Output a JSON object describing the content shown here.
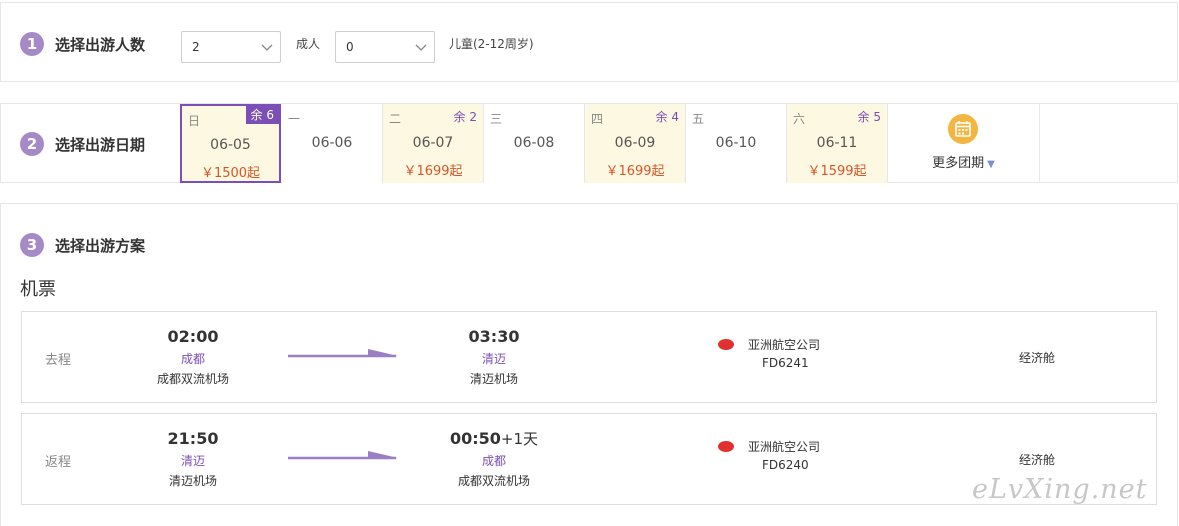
{
  "step1": {
    "num": "1",
    "title": "选择出游人数",
    "adults": {
      "value": "2",
      "label": "成人"
    },
    "children": {
      "value": "0",
      "label": "儿童(2-12周岁)"
    }
  },
  "step2": {
    "num": "2",
    "title": "选择出游日期",
    "days": [
      {
        "weekday": "日",
        "remain": "余 6",
        "date": "06-05",
        "price": "￥1500起",
        "selected": true
      },
      {
        "weekday": "一",
        "remain": "",
        "date": "06-06",
        "price": ""
      },
      {
        "weekday": "二",
        "remain": "余 2",
        "date": "06-07",
        "price": "￥1699起"
      },
      {
        "weekday": "三",
        "remain": "",
        "date": "06-08",
        "price": ""
      },
      {
        "weekday": "四",
        "remain": "余 4",
        "date": "06-09",
        "price": "￥1699起"
      },
      {
        "weekday": "五",
        "remain": "",
        "date": "06-10",
        "price": ""
      },
      {
        "weekday": "六",
        "remain": "余 5",
        "date": "06-11",
        "price": "￥1599起"
      }
    ],
    "more_label": "更多团期",
    "more_icon": "calendar-icon"
  },
  "step3": {
    "num": "3",
    "title": "选择出游方案",
    "subtitle": "机票",
    "flights": [
      {
        "direction": "去程",
        "dep_time": "02:00",
        "dep_city": "成都",
        "dep_airport": "成都双流机场",
        "arr_time": "03:30",
        "arr_plus": "",
        "arr_city": "清迈",
        "arr_airport": "清迈机场",
        "airline": "亚洲航空公司",
        "flight_no": "FD6241",
        "cabin": "经济舱"
      },
      {
        "direction": "返程",
        "dep_time": "21:50",
        "dep_city": "清迈",
        "dep_airport": "清迈机场",
        "arr_time": "00:50",
        "arr_plus": "+1天",
        "arr_city": "成都",
        "arr_airport": "成都双流机场",
        "airline": "亚洲航空公司",
        "flight_no": "FD6240",
        "cabin": "经济舱"
      }
    ]
  },
  "watermark": "eLvXing.net",
  "colors": {
    "accent": "#7b4fb6",
    "step_circle": "#a58ac7",
    "price": "#d4572b",
    "highlight_bg": "#fdf8e1",
    "airline_logo": "#e03130"
  }
}
